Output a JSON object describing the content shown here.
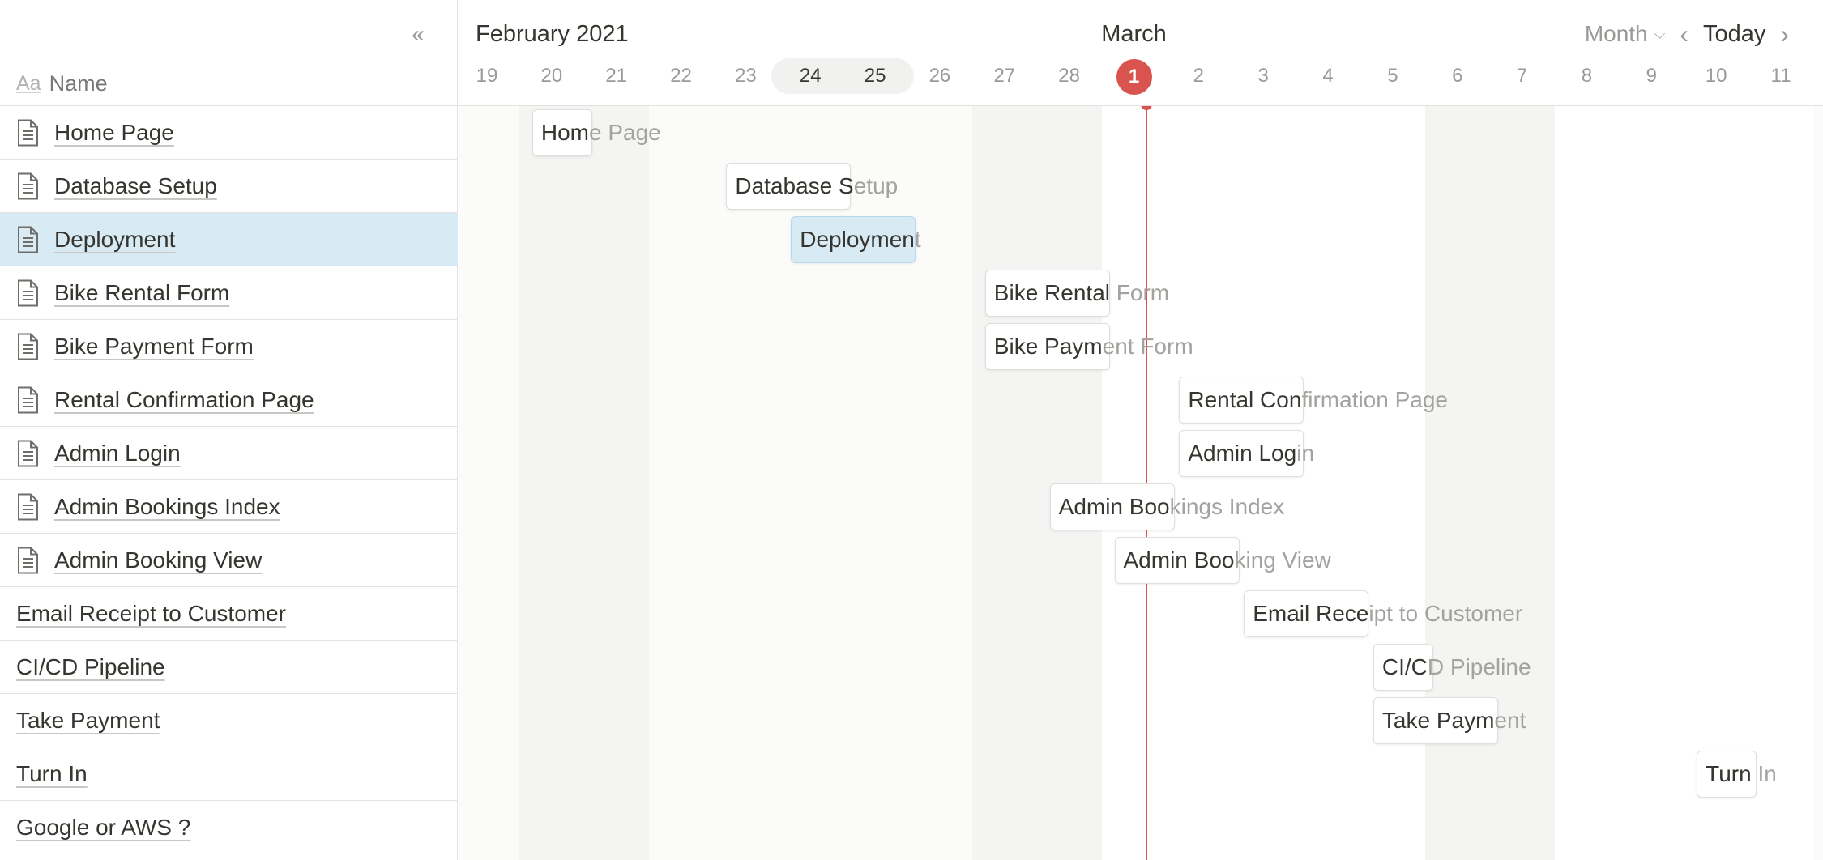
{
  "sidebar": {
    "collapse_icon": "double-chevron-left-icon",
    "name_header": {
      "icon_text": "Aa",
      "label": "Name"
    },
    "rows": [
      {
        "label": "Home Page",
        "doc": true
      },
      {
        "label": "Database Setup",
        "doc": true
      },
      {
        "label": "Deployment",
        "doc": true,
        "selected": true
      },
      {
        "label": "Bike Rental Form",
        "doc": true
      },
      {
        "label": "Bike Payment Form",
        "doc": true
      },
      {
        "label": "Rental Confirmation Page",
        "doc": true
      },
      {
        "label": "Admin Login",
        "doc": true
      },
      {
        "label": "Admin Bookings Index",
        "doc": true
      },
      {
        "label": "Admin Booking View",
        "doc": true
      },
      {
        "label": "Email Receipt to Customer",
        "doc": false
      },
      {
        "label": "CI/CD Pipeline",
        "doc": false
      },
      {
        "label": "Take Payment",
        "doc": false
      },
      {
        "label": "Turn In",
        "doc": false
      },
      {
        "label": "Google or AWS ?",
        "doc": false
      }
    ]
  },
  "timeline": {
    "month_labels": [
      {
        "text": "February 2021",
        "start_day_index": 0
      },
      {
        "text": "March",
        "center_day_index": 10
      }
    ],
    "view_select": {
      "label": "Month",
      "icon": "chevron-down-icon"
    },
    "prev_icon": "chevron-left-icon",
    "next_icon": "chevron-right-icon",
    "today_label": "Today",
    "days": [
      "19",
      "20",
      "21",
      "22",
      "23",
      "24",
      "25",
      "26",
      "27",
      "28",
      "1",
      "2",
      "3",
      "4",
      "5",
      "6",
      "7",
      "8",
      "9",
      "10",
      "11"
    ],
    "selected_days": [
      "24",
      "25"
    ],
    "today": "1",
    "today_color": "#d9534f",
    "selected_color": "#d8ebf5",
    "bars": [
      {
        "label": "Home Page",
        "day_index": 1,
        "visible_chars": "Hom",
        "rest": "e Page"
      },
      {
        "label": "Database Setup",
        "day_index": 4,
        "visible_chars": "Database S",
        "rest": "etup",
        "span": 2
      },
      {
        "label": "Deployment",
        "day_index": 5,
        "visible_chars": "Deploymen",
        "rest": "t",
        "span": 2,
        "selected": true
      },
      {
        "label": "Bike Rental Form",
        "day_index": 8,
        "visible_chars": "Bike Rental",
        "rest": " Form",
        "span": 2
      },
      {
        "label": "Bike Payment Form",
        "day_index": 8,
        "visible_chars": "Bike Paym",
        "rest": "ent Form",
        "span": 2
      },
      {
        "label": "Rental Confirmation Page",
        "day_index": 11,
        "visible_chars": "Rental Con",
        "rest": "firmation Page",
        "span": 2
      },
      {
        "label": "Admin Login",
        "day_index": 11,
        "visible_chars": "Admin Log",
        "rest": "in",
        "span": 2
      },
      {
        "label": "Admin Bookings Index",
        "day_index": 9,
        "visible_chars": "Admin Boo",
        "rest": "kings Index",
        "span": 2
      },
      {
        "label": "Admin Booking View",
        "day_index": 10,
        "visible_chars": "Admin Boo",
        "rest": "king View",
        "span": 2
      },
      {
        "label": "Email Receipt to Customer",
        "day_index": 12,
        "visible_chars": "Email Rece",
        "rest": "ipt to Customer",
        "span": 2
      },
      {
        "label": "CI/CD Pipeline",
        "day_index": 14,
        "visible_chars": "CI/C",
        "rest": "D Pipeline",
        "span": 1
      },
      {
        "label": "Take Payment",
        "day_index": 14,
        "visible_chars": "Take Paym",
        "rest": "ent",
        "span": 2
      },
      {
        "label": "Turn In",
        "day_index": 19,
        "visible_chars": "Turn",
        "rest": " In",
        "span": 1
      }
    ]
  }
}
